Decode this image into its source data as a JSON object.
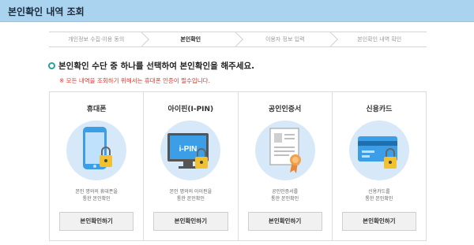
{
  "header": {
    "title": "본인확인 내역 조회"
  },
  "steps": [
    {
      "label": "개인정보 수집·이용 동의",
      "active": false
    },
    {
      "label": "본인확인",
      "active": true
    },
    {
      "label": "이용자 정보 입력",
      "active": false
    },
    {
      "label": "본인확인 내역 확인",
      "active": false
    }
  ],
  "main": {
    "heading": "본인확인 수단 중 하나를 선택하여 본인확인을 해주세요.",
    "notice": "※ 모든 내역을 조회하기 위해서는 휴대폰 인증이 필수입니다."
  },
  "cards": [
    {
      "title": "휴대폰",
      "desc1": "본인 명의의 휴대폰을",
      "desc2": "통한 본인확인",
      "button": "본인확인하기",
      "icon": "phone-lock-icon"
    },
    {
      "title": "아이핀(I-PIN)",
      "desc1": "본인 명의의 아이핀을",
      "desc2": "통한 본인확인",
      "button": "본인확인하기",
      "icon": "ipin-monitor-lock-icon",
      "ipin_text": "i-PIN"
    },
    {
      "title": "공인인증서",
      "desc1": "공인인증서를",
      "desc2": "통한 본인확인",
      "button": "본인확인하기",
      "icon": "certificate-icon"
    },
    {
      "title": "신용카드",
      "desc1": "신용카드를",
      "desc2": "통한 본인확인",
      "button": "본인확인하기",
      "icon": "credit-card-lock-icon"
    }
  ],
  "colors": {
    "header_bg": "#a9d3ef",
    "circle_bg": "#d7e9f8",
    "accent_blue": "#3b9ee6",
    "lock_yellow": "#f2c12e",
    "notice_red": "#e8342d"
  }
}
